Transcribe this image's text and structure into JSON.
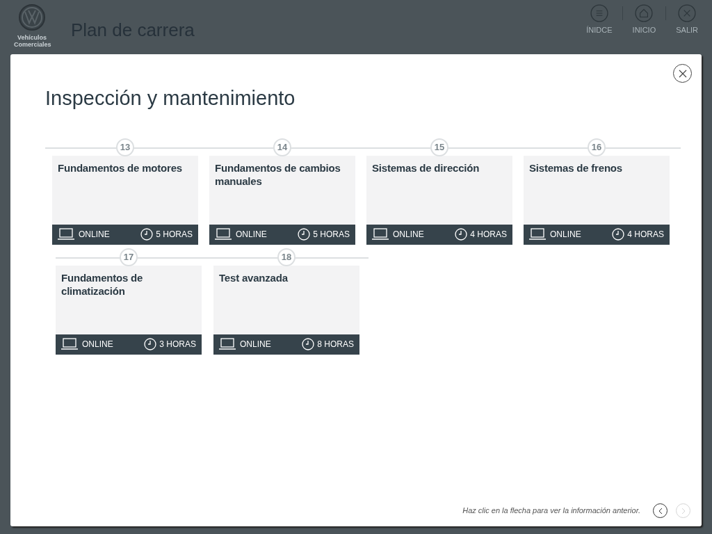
{
  "header": {
    "logo_text": "Vehículos Comerciales",
    "title": "Plan de carrera",
    "nav": [
      {
        "kind": "index",
        "label": "ÍNIDCE"
      },
      {
        "kind": "home",
        "label": "INICIO"
      },
      {
        "kind": "exit",
        "label": "SALIR"
      }
    ]
  },
  "modal": {
    "title": "Inspección y mantenimiento",
    "rows": [
      [
        {
          "number": "13",
          "title": "Fundamentos de motores",
          "mode": "ONLINE",
          "duration": "5 HORAS"
        },
        {
          "number": "14",
          "title": "Fundamentos de cambios manuales",
          "mode": "ONLINE",
          "duration": "5 HORAS"
        },
        {
          "number": "15",
          "title": "Sistemas de dirección",
          "mode": "ONLINE",
          "duration": "4 HORAS"
        },
        {
          "number": "16",
          "title": "Sistemas de frenos",
          "mode": "ONLINE",
          "duration": "4 HORAS"
        }
      ],
      [
        {
          "number": "17",
          "title": "Fundamentos de climatización",
          "mode": "ONLINE",
          "duration": "3 HORAS"
        },
        {
          "number": "18",
          "title": "Test avanzada",
          "mode": "ONLINE",
          "duration": "8 HORAS"
        }
      ]
    ],
    "hint": "Haz clic en la flecha para ver la información anterior.",
    "prev_disabled": false,
    "next_disabled": true
  }
}
